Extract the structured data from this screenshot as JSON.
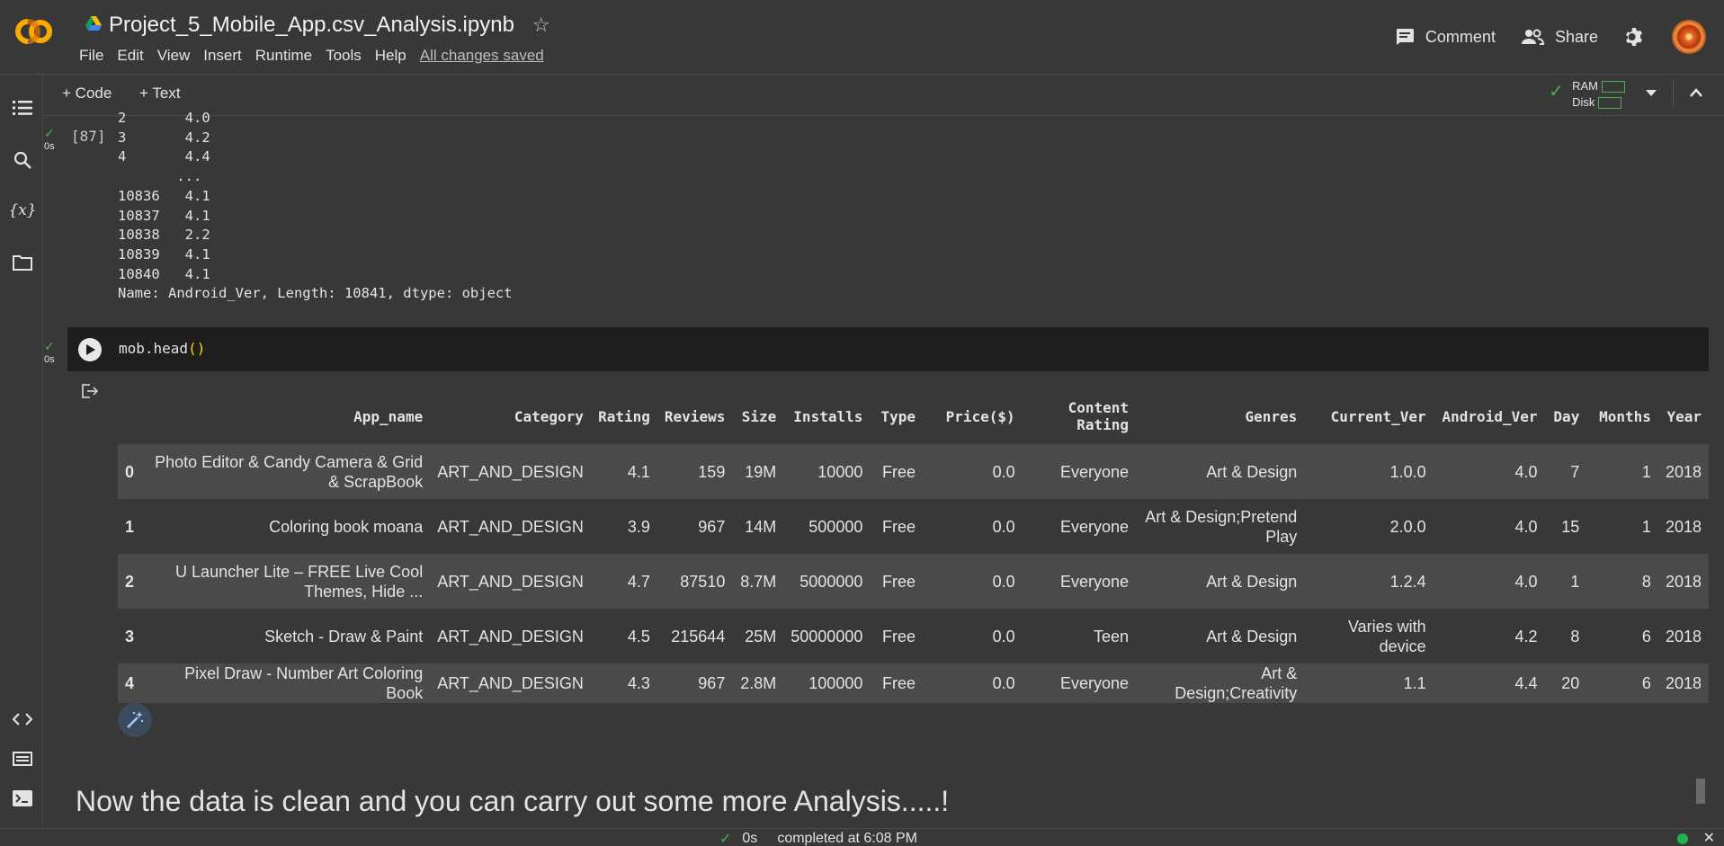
{
  "header": {
    "title": "Project_5_Mobile_App.csv_Analysis.ipynb",
    "menu": [
      "File",
      "Edit",
      "View",
      "Insert",
      "Runtime",
      "Tools",
      "Help"
    ],
    "saved_status": "All changes saved",
    "comment_label": "Comment",
    "share_label": "Share"
  },
  "toolbar": {
    "code_label": "Code",
    "text_label": "Text",
    "ram_label": "RAM",
    "disk_label": "Disk"
  },
  "output_cell": {
    "exec_count": "[87]",
    "time": "0s",
    "stream_text": "2       4.0\n3       4.2\n4       4.4\n       ...\n10836   4.1\n10837   4.1\n10838   2.2\n10839   4.1\n10840   4.1\nName: Android_Ver, Length: 10841, dtype: object"
  },
  "code_cell": {
    "time": "0s",
    "code_prefix": "mob.head",
    "code_parens": "()"
  },
  "table": {
    "columns": [
      "",
      "App_name",
      "Category",
      "Rating",
      "Reviews",
      "Size",
      "Installs",
      "Type",
      "Price($)",
      "Content Rating",
      "Genres",
      "Current_Ver",
      "Android_Ver",
      "Day",
      "Months",
      "Year"
    ],
    "rows": [
      [
        "0",
        "Photo Editor & Candy Camera & Grid & ScrapBook",
        "ART_AND_DESIGN",
        "4.1",
        "159",
        "19M",
        "10000",
        "Free",
        "0.0",
        "Everyone",
        "Art & Design",
        "1.0.0",
        "4.0",
        "7",
        "1",
        "2018"
      ],
      [
        "1",
        "Coloring book moana",
        "ART_AND_DESIGN",
        "3.9",
        "967",
        "14M",
        "500000",
        "Free",
        "0.0",
        "Everyone",
        "Art & Design;Pretend Play",
        "2.0.0",
        "4.0",
        "15",
        "1",
        "2018"
      ],
      [
        "2",
        "U Launcher Lite – FREE Live Cool Themes, Hide ...",
        "ART_AND_DESIGN",
        "4.7",
        "87510",
        "8.7M",
        "5000000",
        "Free",
        "0.0",
        "Everyone",
        "Art & Design",
        "1.2.4",
        "4.0",
        "1",
        "8",
        "2018"
      ],
      [
        "3",
        "Sketch - Draw & Paint",
        "ART_AND_DESIGN",
        "4.5",
        "215644",
        "25M",
        "50000000",
        "Free",
        "0.0",
        "Teen",
        "Art & Design",
        "Varies with device",
        "4.2",
        "8",
        "6",
        "2018"
      ],
      [
        "4",
        "Pixel Draw - Number Art Coloring Book",
        "ART_AND_DESIGN",
        "4.3",
        "967",
        "2.8M",
        "100000",
        "Free",
        "0.0",
        "Everyone",
        "Art & Design;Creativity",
        "1.1",
        "4.4",
        "20",
        "6",
        "2018"
      ]
    ]
  },
  "markdown": {
    "text": "Now the data is clean and you can carry out some more Analysis.....!"
  },
  "statusbar": {
    "time": "0s",
    "completed": "completed at 6:08 PM"
  },
  "colors": {
    "accent_green": "#4caf50",
    "logo_orange": "#f9ab00",
    "background": "#383838"
  }
}
